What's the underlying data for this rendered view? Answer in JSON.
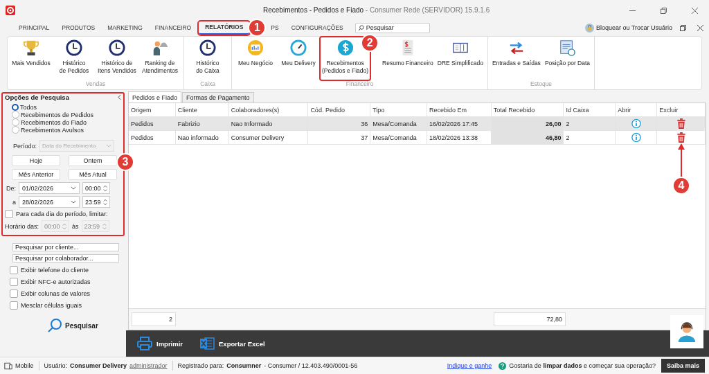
{
  "window": {
    "title": "Recebimentos - Pedidos e Fiado",
    "subtitle": "- Consumer Rede (SERVIDOR) 15.9.1.6"
  },
  "menu_tabs": [
    {
      "label": "PRINCIPAL",
      "selected": false
    },
    {
      "label": "PRODUTOS",
      "selected": false
    },
    {
      "label": "MARKETING",
      "selected": false
    },
    {
      "label": "FINANCEIRO",
      "selected": false
    },
    {
      "label": "RELATÓRIOS",
      "selected": true
    },
    {
      "label": "PS",
      "selected": false
    },
    {
      "label": "CONFIGURAÇÕES",
      "selected": false
    }
  ],
  "search": {
    "placeholder": "Pesquisar"
  },
  "user_switch": "Bloquear ou Trocar Usuário",
  "ribbon": [
    {
      "label": "Vendas",
      "items": [
        {
          "label": "Mais Vendidos"
        },
        {
          "label": "Histórico\nde Pedidos"
        },
        {
          "label": "Histórico de\nItens Vendidos"
        },
        {
          "label": "Ranking de\nAtendimentos"
        }
      ]
    },
    {
      "label": "Caixa",
      "items": [
        {
          "label": "Histórico\ndo Caixa"
        }
      ]
    },
    {
      "label": "Financeiro",
      "items": [
        {
          "label": "Meu Negócio"
        },
        {
          "label": "Meu Delivery"
        },
        {
          "label": "Recebimentos\n(Pedidos e Fiado)"
        },
        {
          "label": "Resumo Financeiro"
        },
        {
          "label": "DRE Simplificado"
        }
      ]
    },
    {
      "label": "Estoque",
      "items": [
        {
          "label": "Entradas e Saídas"
        },
        {
          "label": "Posição por Data"
        }
      ]
    }
  ],
  "search_options": {
    "title": "Opções de Pesquisa",
    "radios": [
      {
        "label": "Todos",
        "selected": true
      },
      {
        "label": "Recebimentos de Pedidos",
        "selected": false
      },
      {
        "label": "Recebimentos do Fiado",
        "selected": false
      },
      {
        "label": "Recebimentos Avulsos",
        "selected": false
      }
    ],
    "period_label": "Período:",
    "period_value": "Data do Recebimento",
    "period_disabled": true,
    "quick_buttons": [
      "Hoje",
      "Ontem",
      "Mês Anterior",
      "Mês Atual"
    ],
    "from_label": "De:",
    "from_date": "01/02/2026",
    "from_time": "00:00",
    "to_label": "a",
    "to_date": "28/02/2026",
    "to_time": "23:59",
    "limit": {
      "label": "Para cada dia do período, limitar:",
      "checked": false
    },
    "hours_label": "Horário das:",
    "hours_from": "00:00",
    "hours_sep": "às",
    "hours_to": "23:59",
    "hours_disabled": true
  },
  "client_search": {
    "placeholder": "Pesquisar por cliente..."
  },
  "collaborator_search": {
    "placeholder": "Pesquisar por colaborador..."
  },
  "options": [
    {
      "label": "Exibir telefone do cliente",
      "checked": false
    },
    {
      "label": "Exibir NFC-e autorizadas",
      "checked": false
    },
    {
      "label": "Exibir colunas de valores",
      "checked": false
    },
    {
      "label": "Mesclar células iguais",
      "checked": false
    }
  ],
  "search_button": "Pesquisar",
  "content_tabs": [
    {
      "label": "Pedidos e Fiado",
      "selected": true
    },
    {
      "label": "Formas de Pagamento",
      "selected": false
    }
  ],
  "table": {
    "columns": [
      "Origem",
      "Cliente",
      "Colaboradores(s)",
      "Cód. Pedido",
      "Tipo",
      "Recebido Em",
      "Total Recebido",
      "Id Caixa",
      "Abrir",
      "Excluir"
    ],
    "rows": [
      {
        "selected": true,
        "cells": [
          "Pedidos",
          "Fabrizio",
          "Nao Informado",
          "36",
          "Mesa/Comanda",
          "16/02/2026 17:45",
          "26,00",
          "2"
        ]
      },
      {
        "selected": false,
        "cells": [
          "Pedidos",
          "Nao informado",
          "Consumer Delivery",
          "37",
          "Mesa/Comanda",
          "18/02/2026 13:38",
          "46,80",
          "2"
        ]
      }
    ]
  },
  "totals": {
    "count": "2",
    "total": "72,80"
  },
  "toolbar": [
    {
      "label": "Imprimir",
      "kind": "print"
    },
    {
      "label": "Exportar Excel",
      "kind": "excel"
    }
  ],
  "status_bar": {
    "mode": "Mobile",
    "user_label": "Usuário:",
    "user": "Consumer Delivery",
    "role": "administrador",
    "registered_label": "Registrado para:",
    "registered": "Consumner",
    "registered_rest": "- Consumer / 12.403.490/0001-56",
    "link": "Indique e ganhe",
    "question": "Gostaria de **limpar dados** e começar sua operação?",
    "button": "Saiba mais"
  },
  "callouts": [
    "1",
    "2",
    "3",
    "4"
  ]
}
